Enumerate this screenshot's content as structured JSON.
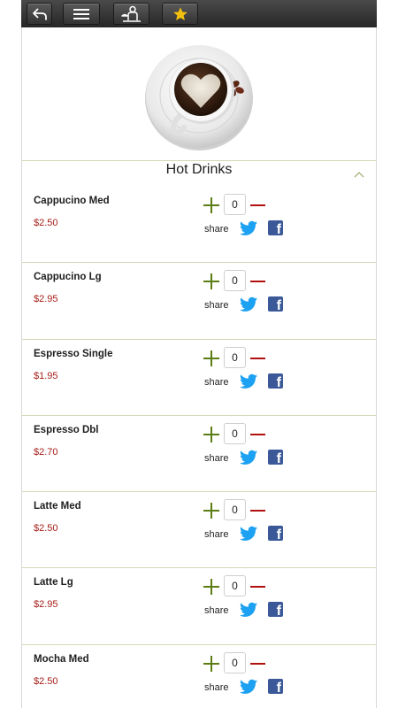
{
  "toolbar": {
    "buttons": [
      {
        "name": "back-button",
        "icon": "back-arrow-icon"
      },
      {
        "name": "menu-button",
        "icon": "hamburger-menu-icon"
      },
      {
        "name": "waiter-button",
        "icon": "waiter-icon"
      },
      {
        "name": "favorites-button",
        "icon": "star-icon"
      }
    ]
  },
  "hero": {
    "icon": "coffee-cup-icon"
  },
  "section": {
    "title": "Hot Drinks",
    "collapse_icon": "chevron-up-icon"
  },
  "colors": {
    "toolbar": "#333333",
    "star": "#f2c10d",
    "plus": "#5b7d14",
    "minus": "#b01010",
    "price": "#a8201a",
    "divider": "#d4d9b8",
    "twitter": "#1da1f2",
    "facebook": "#3b5998"
  },
  "share_label": "share",
  "items": [
    {
      "name": "Cappucino Med",
      "price": "$2.50",
      "qty": "0"
    },
    {
      "name": "Cappucino Lg",
      "price": "$2.95",
      "qty": "0"
    },
    {
      "name": "Espresso Single",
      "price": "$1.95",
      "qty": "0"
    },
    {
      "name": "Espresso Dbl",
      "price": "$2.70",
      "qty": "0"
    },
    {
      "name": "Latte Med",
      "price": "$2.50",
      "qty": "0"
    },
    {
      "name": "Latte Lg",
      "price": "$2.95",
      "qty": "0"
    },
    {
      "name": "Mocha Med",
      "price": "$2.50",
      "qty": "0"
    }
  ]
}
